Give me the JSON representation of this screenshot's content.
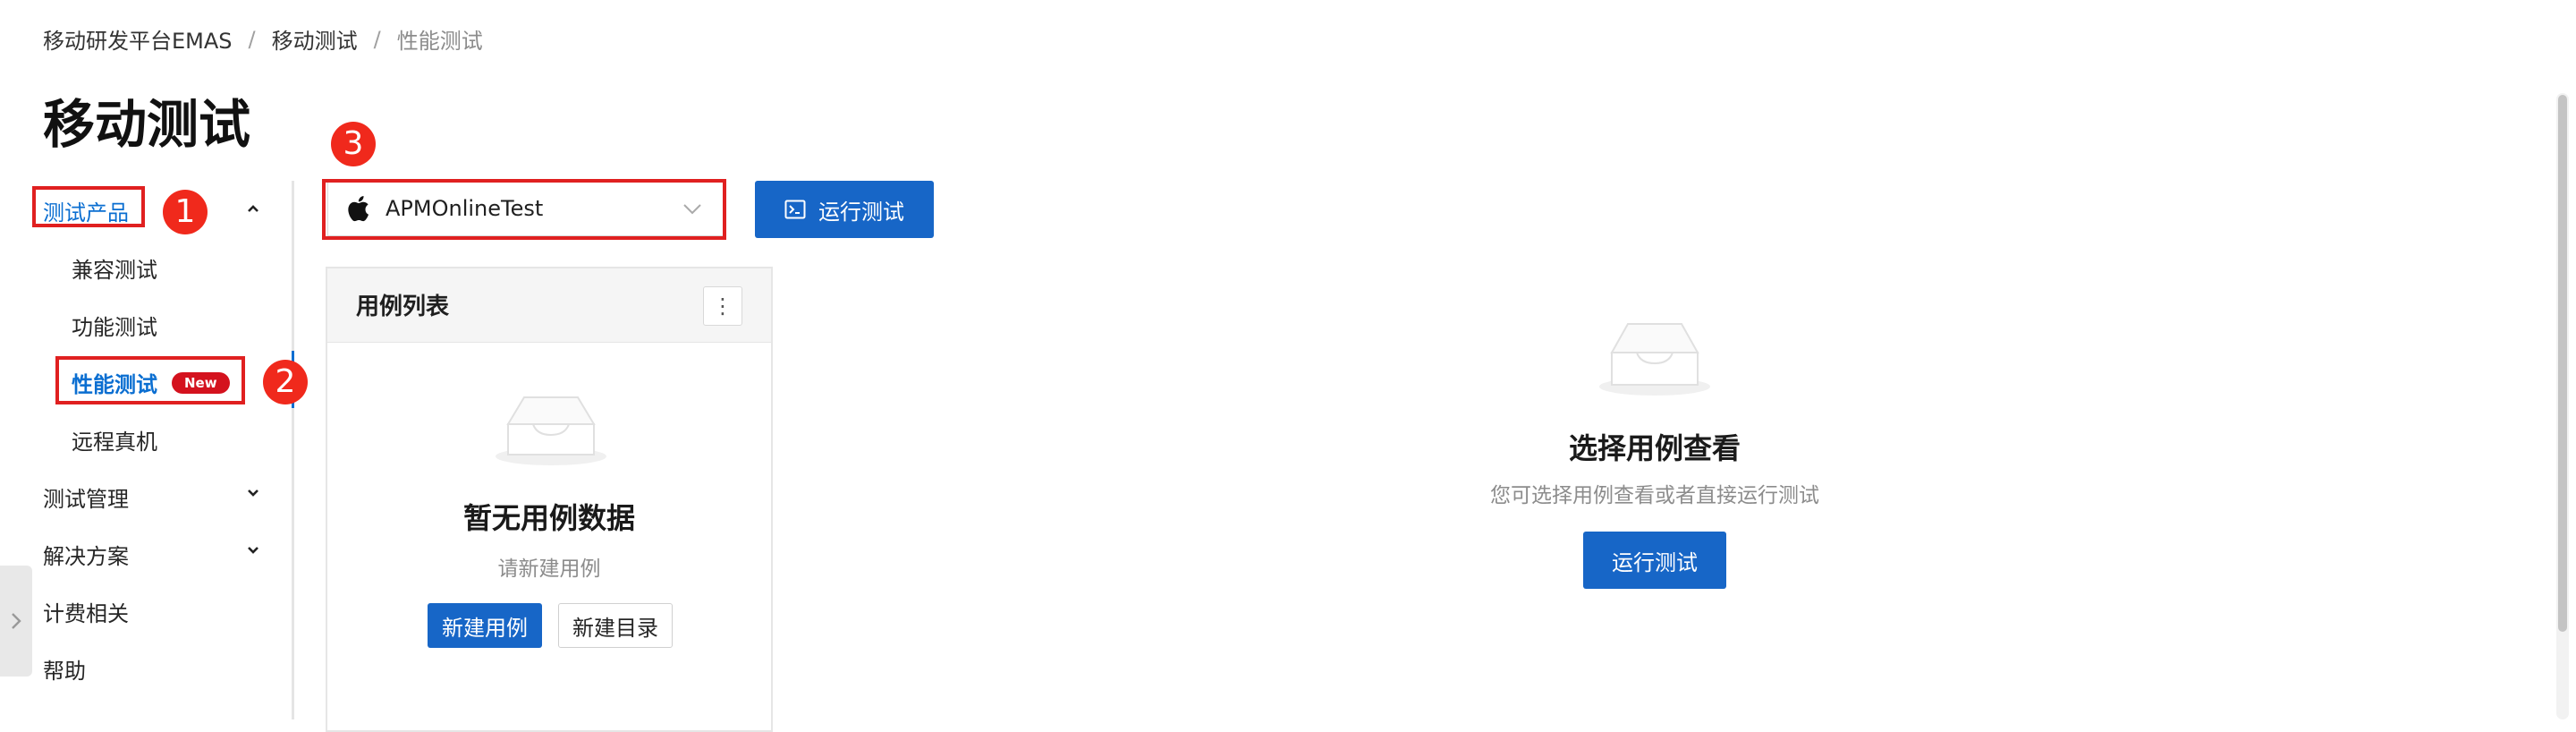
{
  "breadcrumb": {
    "items": [
      "移动研发平台EMAS",
      "移动测试"
    ],
    "current": "性能测试",
    "separator": "/"
  },
  "page_title": "移动测试",
  "sidebar": {
    "sections": [
      {
        "label": "测试产品",
        "expanded": true,
        "items": [
          "兼容测试",
          "功能测试",
          "性能测试",
          "远程真机"
        ],
        "active_item": "性能测试",
        "active_badge": "New"
      },
      {
        "label": "测试管理",
        "expanded": false
      },
      {
        "label": "解决方案",
        "expanded": false
      },
      {
        "label": "计费相关"
      },
      {
        "label": "帮助"
      }
    ]
  },
  "annotations": [
    "1",
    "2",
    "3"
  ],
  "app_select": {
    "value": "APMOnlineTest",
    "icon": "apple-icon"
  },
  "run_test_button": "运行测试",
  "case_panel": {
    "title": "用例列表",
    "more_icon": "⋮",
    "empty_title": "暂无用例数据",
    "empty_desc": "请新建用例",
    "new_case_button": "新建用例",
    "new_dir_button": "新建目录"
  },
  "detail_empty": {
    "title": "选择用例查看",
    "desc": "您可选择用例查看或者直接运行测试",
    "run_button": "运行测试"
  },
  "colors": {
    "primary": "#1766c7",
    "active": "#0a6ed1",
    "annotation": "#e02020",
    "badge": "#d4121e"
  }
}
